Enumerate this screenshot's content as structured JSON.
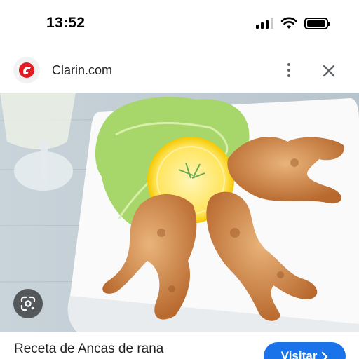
{
  "status_bar": {
    "time": "13:52",
    "icons": [
      "cellular-signal-icon",
      "wifi-icon",
      "battery-icon"
    ]
  },
  "header": {
    "site_name": "Clarin.com",
    "logo_icon": "clarin-logo-icon",
    "more_icon": "more-vert-icon",
    "close_icon": "close-icon"
  },
  "image": {
    "subject": "frog-legs-dish-photo"
  },
  "lens_button": {
    "icon": "google-lens-icon"
  },
  "result": {
    "title": "Receta de Ancas de rana",
    "visit_label": "Visitar",
    "visit_icon": "chevron-right-icon"
  },
  "colors": {
    "accent": "#1a73e8",
    "brand_red": "#e31b23",
    "text": "#202124",
    "icon_gray": "#5f6368"
  }
}
